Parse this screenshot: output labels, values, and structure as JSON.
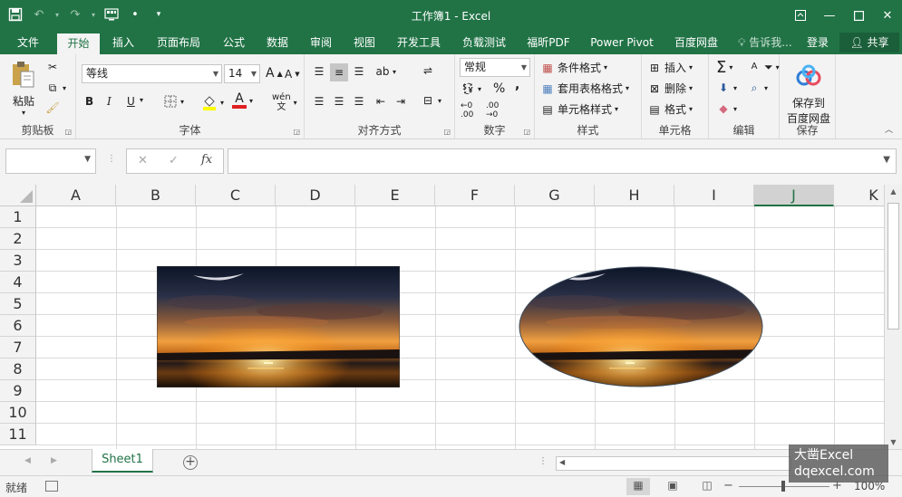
{
  "window": {
    "title": "工作簿1 - Excel",
    "qat_icons": [
      "save-icon",
      "undo-icon",
      "redo-icon",
      "touch-mode-icon",
      "qat-customize-icon"
    ]
  },
  "tabs": {
    "items": [
      {
        "label": "文件"
      },
      {
        "label": "开始"
      },
      {
        "label": "插入"
      },
      {
        "label": "页面布局"
      },
      {
        "label": "公式"
      },
      {
        "label": "数据"
      },
      {
        "label": "审阅"
      },
      {
        "label": "视图"
      },
      {
        "label": "开发工具"
      },
      {
        "label": "负载测试"
      },
      {
        "label": "福昕PDF"
      },
      {
        "label": "Power Pivot"
      },
      {
        "label": "百度网盘"
      }
    ],
    "active_index": 1,
    "tell_me": "告诉我...",
    "login": "登录",
    "share": "共享"
  },
  "ribbon": {
    "clipboard": {
      "label": "剪贴板",
      "paste": "粘贴"
    },
    "font": {
      "label": "字体",
      "font_name": "等线",
      "font_size": "14",
      "bold": "B",
      "italic": "I",
      "underline": "U",
      "grow": "A",
      "shrink": "A",
      "wen": "wén",
      "font_color": "A"
    },
    "alignment": {
      "label": "对齐方式"
    },
    "number": {
      "label": "数字",
      "format": "常规",
      "percent": "%",
      "comma": ","
    },
    "styles": {
      "label": "样式",
      "conditional": "条件格式",
      "table": "套用表格格式",
      "cell": "单元格样式"
    },
    "cells": {
      "label": "单元格",
      "insert": "插入",
      "delete": "删除",
      "format": "格式"
    },
    "editing": {
      "label": "编辑"
    },
    "save": {
      "label": "保存",
      "button": "保存到\n百度网盘",
      "line1": "保存到",
      "line2": "百度网盘"
    }
  },
  "formula_bar": {
    "name_box": "",
    "fx": "fx",
    "cancel": "✕",
    "enter": "✓",
    "value": ""
  },
  "sheet": {
    "columns": [
      "A",
      "B",
      "C",
      "D",
      "E",
      "F",
      "G",
      "H",
      "I",
      "J",
      "K"
    ],
    "selected_column": "J",
    "rows": [
      "1",
      "2",
      "3",
      "4",
      "5",
      "6",
      "7",
      "8",
      "9",
      "10",
      "11"
    ],
    "pictures": [
      {
        "name": "sunset-picture-rectangle",
        "shape": "rectangle",
        "content": "sunset over water"
      },
      {
        "name": "sunset-picture-oval",
        "shape": "ellipse",
        "content": "sunset over water"
      }
    ]
  },
  "sheet_tabs": {
    "tabs": [
      "Sheet1"
    ],
    "active": "Sheet1"
  },
  "status_bar": {
    "mode": "就绪",
    "zoom": "100%",
    "zoom_minus": "−",
    "zoom_plus": "+"
  },
  "watermark": {
    "line1": "大凿Excel",
    "line2": "dqexcel.com"
  },
  "colors": {
    "brand": "#217346",
    "ribbon_bg": "#f3f3f3",
    "grid_line": "#dadada"
  }
}
